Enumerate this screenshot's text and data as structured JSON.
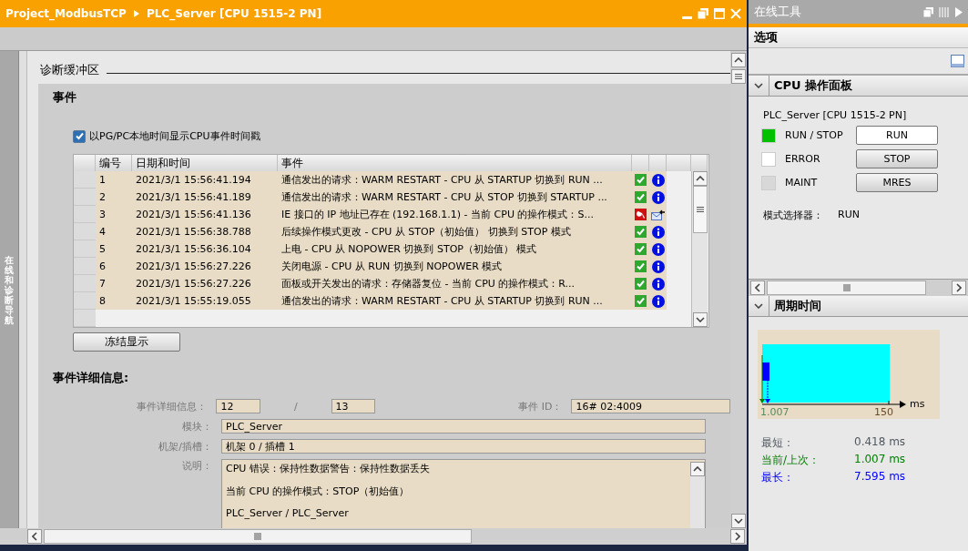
{
  "window": {
    "breadcrumb": [
      "Project_ModbusTCP",
      "PLC_Server [CPU 1515-2 PN]"
    ]
  },
  "side_tab": {
    "label": "在线和诊断导航"
  },
  "section": {
    "title": "诊断缓冲区"
  },
  "events": {
    "title": "事件",
    "local_time": {
      "label": "以PG/PC本地时间显示CPU事件时间戳",
      "checked": true
    },
    "columns": [
      "编号",
      "日期和时间",
      "事件"
    ],
    "rows": [
      {
        "no": "1",
        "time": "2021/3/1 15:56:41.194",
        "event": "通信发出的请求：WARM RESTART - CPU 从 STARTUP 切换到 RUN ...",
        "kind": "info"
      },
      {
        "no": "2",
        "time": "2021/3/1 15:56:41.189",
        "event": "通信发出的请求：WARM RESTART - CPU 从 STOP 切换到 STARTUP ...",
        "kind": "info"
      },
      {
        "no": "3",
        "time": "2021/3/1 15:56:41.136",
        "event": "IE 接口的 IP 地址已存在 (192.168.1.1) - 当前 CPU 的操作模式：S...",
        "kind": "fault"
      },
      {
        "no": "4",
        "time": "2021/3/1 15:56:38.788",
        "event": "后续操作模式更改 - CPU 从 STOP（初始值） 切换到 STOP 模式",
        "kind": "info"
      },
      {
        "no": "5",
        "time": "2021/3/1 15:56:36.104",
        "event": "上电 - CPU 从 NOPOWER 切换到 STOP（初始值） 模式",
        "kind": "info"
      },
      {
        "no": "6",
        "time": "2021/3/1 15:56:27.226",
        "event": "关闭电源 - CPU 从 RUN 切换到 NOPOWER 模式",
        "kind": "info"
      },
      {
        "no": "7",
        "time": "2021/3/1 15:56:27.226",
        "event": "面板或开关发出的请求：存储器复位 - 当前 CPU 的操作模式：R...",
        "kind": "info"
      },
      {
        "no": "8",
        "time": "2021/3/1 15:55:19.055",
        "event": "通信发出的请求：WARM RESTART - CPU 从 STARTUP 切换到 RUN ...",
        "kind": "info"
      }
    ],
    "freeze_button": "冻结显示"
  },
  "details": {
    "title": "事件详细信息:",
    "detail_label": "事件详细信息：",
    "detail_index": "12",
    "separator": "/",
    "detail_total": "13",
    "event_id_label": "事件 ID：",
    "event_id": "16# 02:4009",
    "module_label": "模块：",
    "module": "PLC_Server",
    "rack_label": "机架/插槽：",
    "rack": "机架 0 / 插槽 1",
    "description_label": "说明：",
    "description": [
      "CPU 错误：保持性数据警告：保持性数据丢失",
      "当前 CPU 的操作模式：STOP（初始值）",
      "PLC_Server / PLC_Server"
    ]
  },
  "online_tools": {
    "title": "在线工具",
    "options": "选项",
    "cpu_panel": {
      "title": "CPU 操作面板",
      "device": "PLC_Server [CPU 1515-2 PN]",
      "leds": [
        {
          "label": "RUN / STOP",
          "color": "#00c000",
          "button": "RUN",
          "selected": true
        },
        {
          "label": "ERROR",
          "color": "#ffffff",
          "button": "STOP",
          "selected": false
        },
        {
          "label": "MAINT",
          "color": "#d8d8d8",
          "button": "MRES",
          "selected": false
        }
      ],
      "mode_label": "模式选择器：",
      "mode": "RUN"
    },
    "cycle_time": {
      "title": "周期时间",
      "axis_start": "1.007",
      "axis_end": "150",
      "unit": "ms",
      "stats": [
        {
          "label": "最短：",
          "value": "0.418 ms",
          "kind": "min"
        },
        {
          "label": "当前/上次：",
          "value": "1.007 ms",
          "kind": "current"
        },
        {
          "label": "最长：",
          "value": "7.595 ms",
          "kind": "max"
        }
      ]
    }
  }
}
